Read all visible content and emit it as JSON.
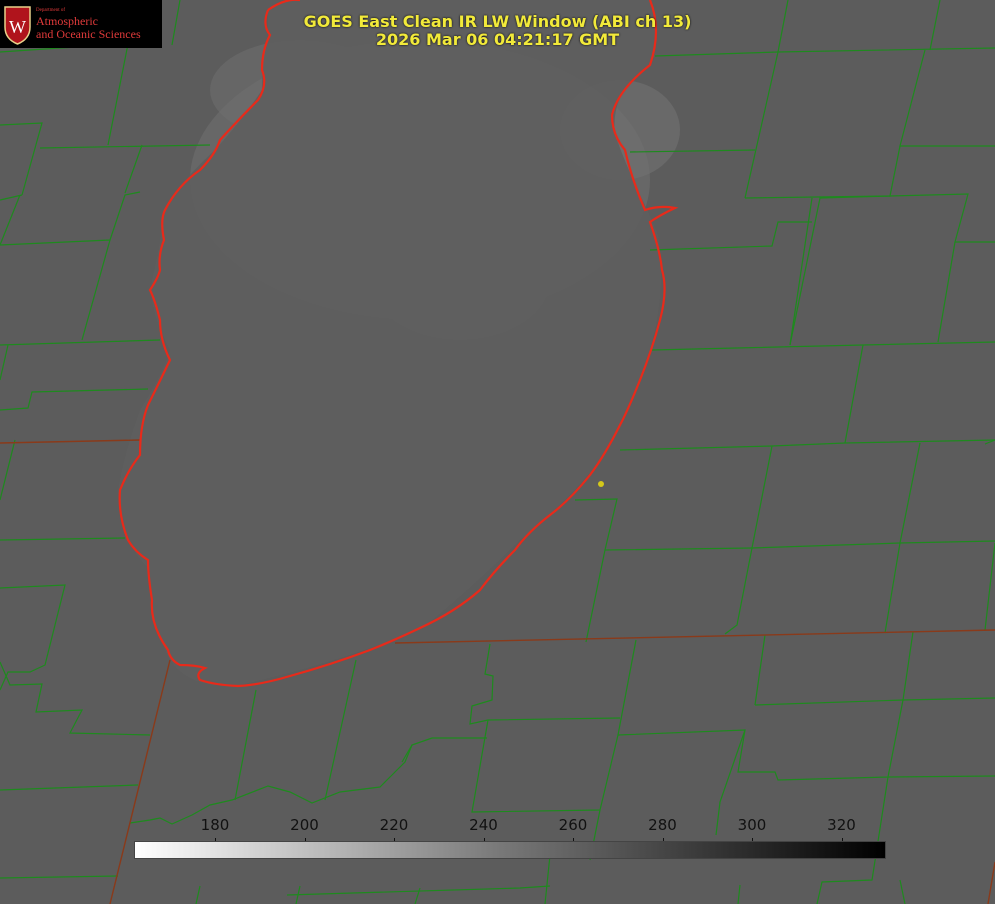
{
  "title": {
    "line1": "GOES East Clean IR LW Window (ABI ch 13)",
    "line2": "2026 Mar 06 04:21:17 GMT"
  },
  "logo": {
    "dept": "Department of",
    "line1": "Atmospheric",
    "line2": "and Oceanic Sciences",
    "seal_letter": "W"
  },
  "colorbar": {
    "ticks": [
      "180",
      "200",
      "220",
      "240",
      "260",
      "280",
      "300",
      "320"
    ],
    "gradient": "white-to-black"
  },
  "colors": {
    "county_lines": "#1e8a1e",
    "lake_shore": "#e82a1a",
    "title_text": "#f2ea3a",
    "marker": "#d4c81a"
  }
}
